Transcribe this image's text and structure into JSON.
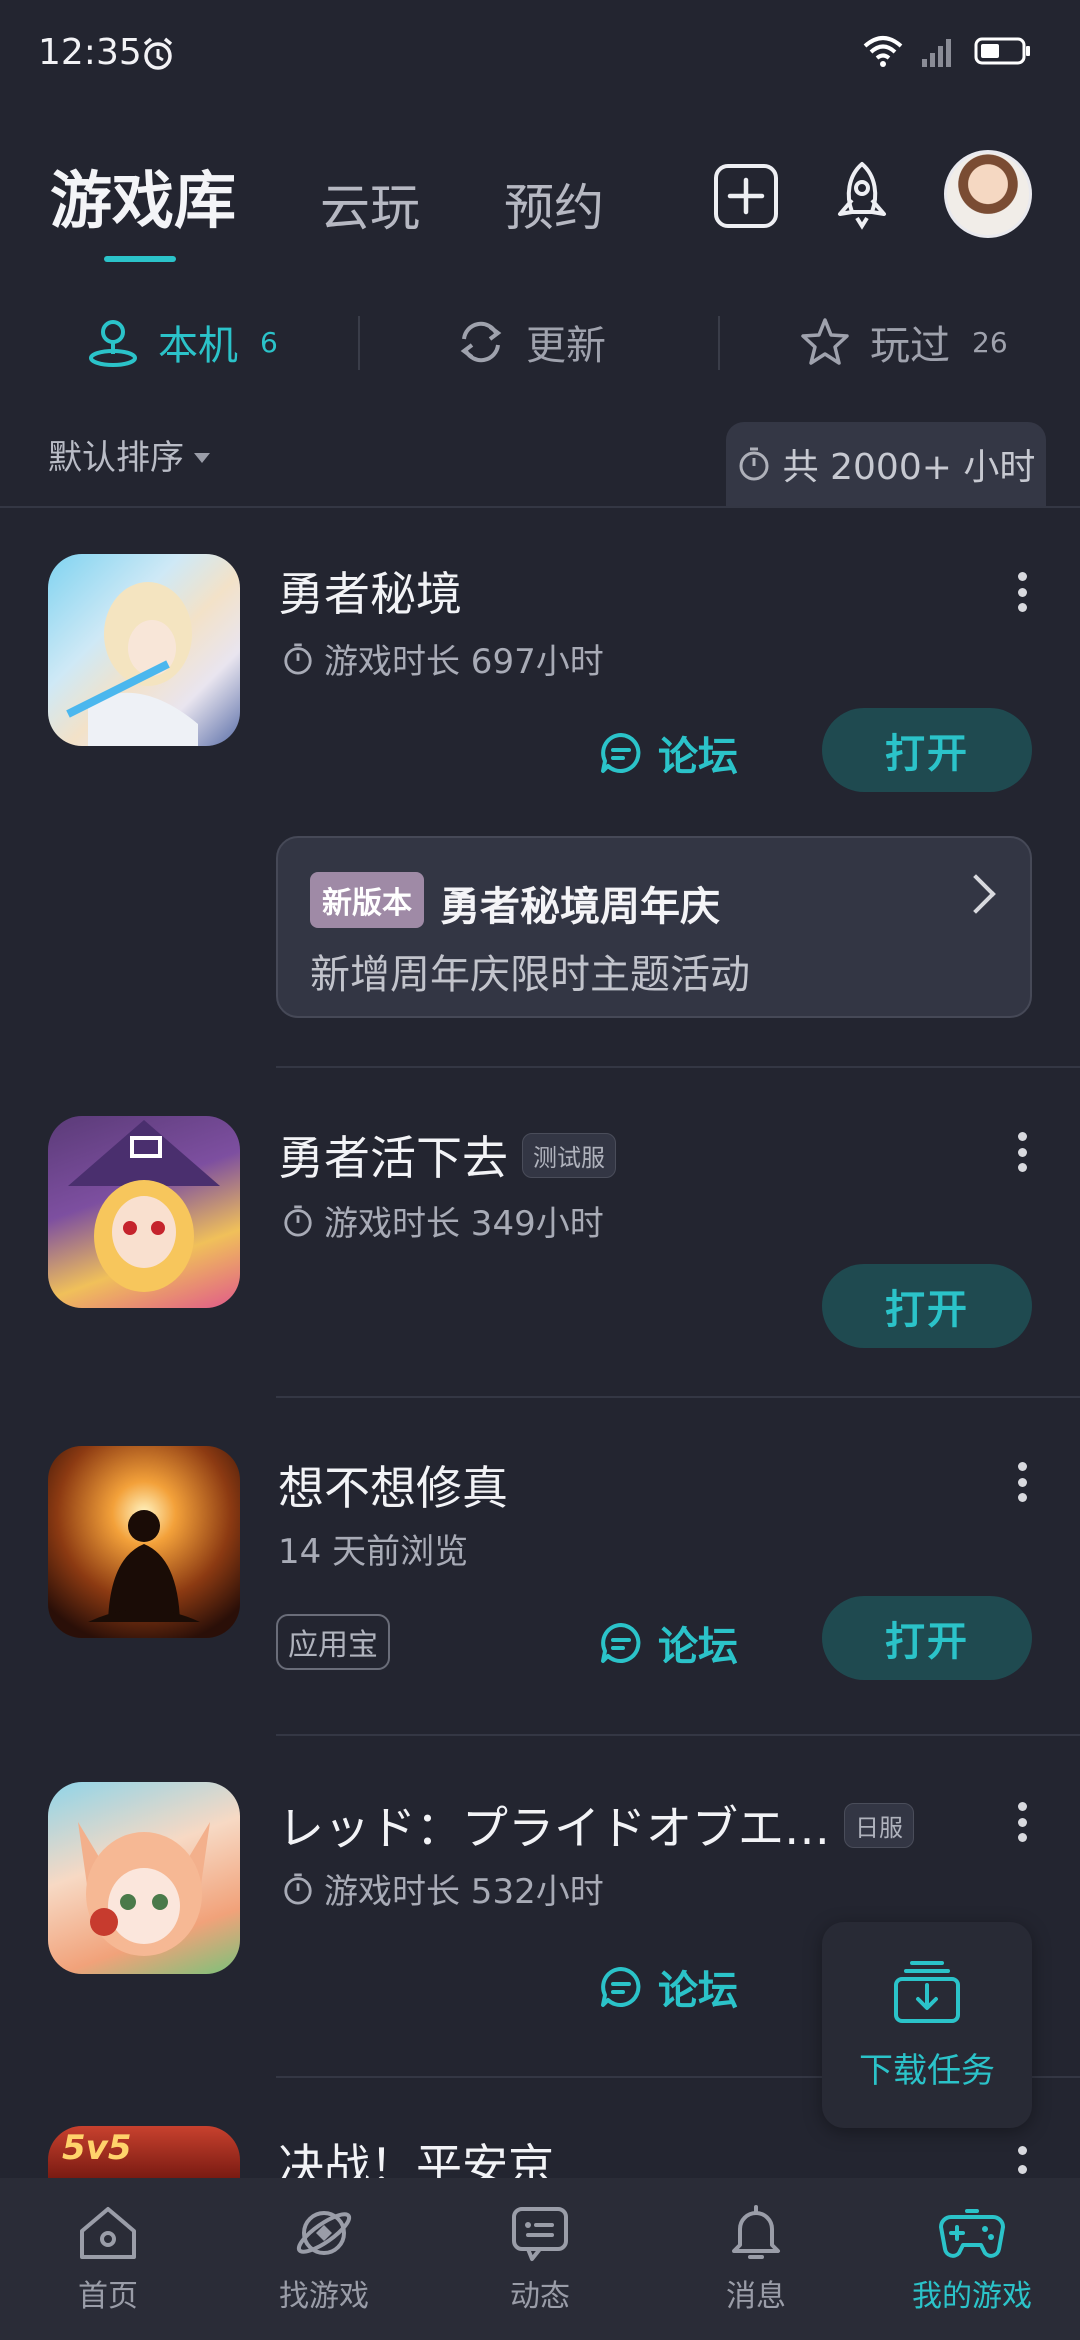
{
  "status": {
    "time": "12:35"
  },
  "nav": {
    "tabs": [
      {
        "label": "游戏库"
      },
      {
        "label": "云玩"
      },
      {
        "label": "预约"
      }
    ]
  },
  "segments": [
    {
      "label": "本机",
      "count": "6"
    },
    {
      "label": "更新",
      "count": ""
    },
    {
      "label": "玩过",
      "count": "26"
    }
  ],
  "sort": {
    "label": "默认排序"
  },
  "total_time": "共 2000+ 小时",
  "games": [
    {
      "title": "勇者秘境",
      "sub": "游戏时长 697小时",
      "forum": "论坛",
      "open": "打开",
      "promo": {
        "badge": "新版本",
        "title": "勇者秘境周年庆",
        "desc": "新增周年庆限时主题活动"
      }
    },
    {
      "title": "勇者活下去",
      "tag": "测试服",
      "sub": "游戏时长 349小时",
      "open": "打开"
    },
    {
      "title": "想不想修真",
      "sub": "14 天前浏览",
      "source_tag": "应用宝",
      "forum": "论坛",
      "open": "打开"
    },
    {
      "title": "レッド：プライドオブエ…",
      "tag": "日服",
      "sub": "游戏时长 532小时",
      "forum": "论坛"
    },
    {
      "title": "决战！平安京",
      "icon_badge": "5v5"
    }
  ],
  "download_task": "下载任务",
  "bottom_nav": [
    {
      "label": "首页",
      "icon": "home-icon"
    },
    {
      "label": "找游戏",
      "icon": "planet-icon"
    },
    {
      "label": "动态",
      "icon": "chat-icon"
    },
    {
      "label": "消息",
      "icon": "bell-icon"
    },
    {
      "label": "我的游戏",
      "icon": "gamepad-icon"
    }
  ],
  "colors": {
    "accent": "#2bc3c9",
    "background": "#232530",
    "card": "#333644"
  }
}
